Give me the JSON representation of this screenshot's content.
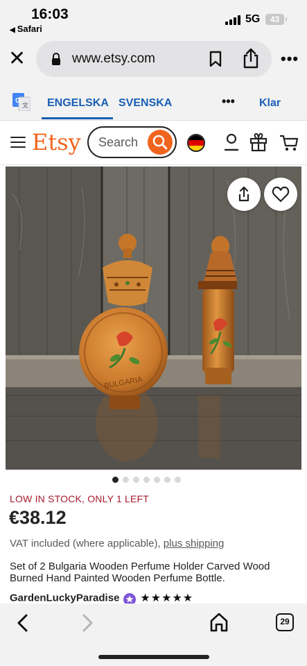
{
  "status_bar": {
    "time": "16:03",
    "back_app": "Safari",
    "network": "5G",
    "battery": "43"
  },
  "browser": {
    "url": "www.etsy.com"
  },
  "translate_bar": {
    "lang_from": "ENGELSKA",
    "lang_to": "SVENSKA",
    "more": "•••",
    "done": "Klar"
  },
  "etsy_header": {
    "logo": "Etsy",
    "search_placeholder": "Search"
  },
  "carousel": {
    "total_images": 7,
    "active_index": 0
  },
  "product": {
    "stock_notice": "LOW IN STOCK, ONLY 1 LEFT",
    "price": "€38.12",
    "vat_text": "VAT included (where applicable),",
    "shipping_link": "plus shipping",
    "title": "Set of 2 Bulgaria Wooden Perfume Holder Carved Wood Burned Hand Painted Wooden Perfume Bottle.",
    "shop_name": "GardenLuckyParadise",
    "rating_stars": "★★★★★",
    "photo_text": "BULGARIA"
  },
  "bottom_bar": {
    "tab_count": "29"
  },
  "colors": {
    "etsy_orange": "#f1641e",
    "translate_blue": "#1a5fb4",
    "stock_red": "#a61a2e",
    "star_seller_purple": "#7f57d6"
  }
}
